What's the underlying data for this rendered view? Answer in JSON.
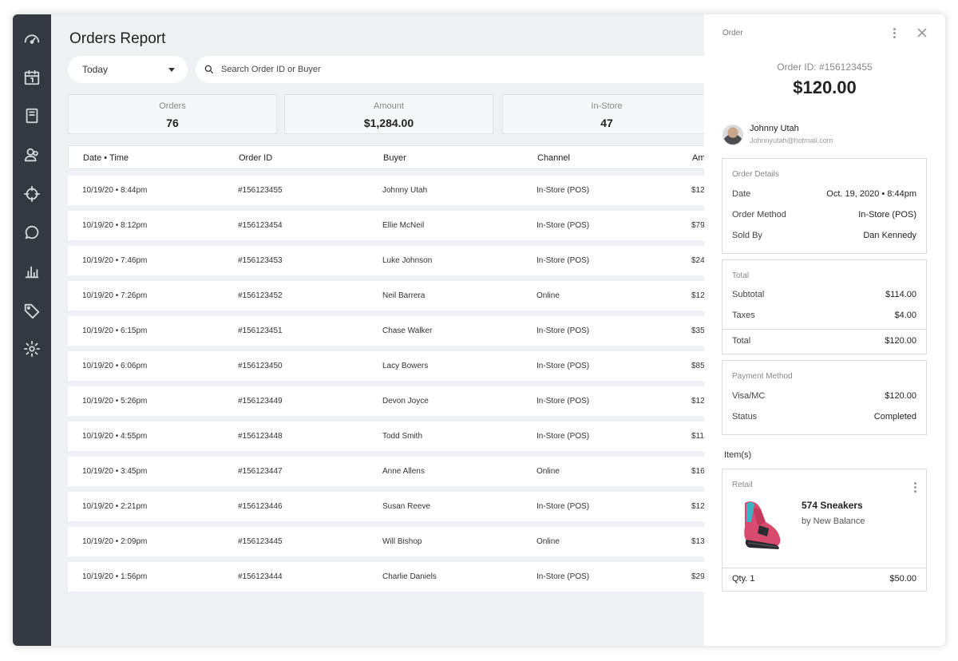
{
  "nav": {
    "items": [
      {
        "name": "dashboard-icon"
      },
      {
        "name": "calendar-icon"
      },
      {
        "name": "book-icon"
      },
      {
        "name": "users-icon"
      },
      {
        "name": "crosshair-icon"
      },
      {
        "name": "chat-icon"
      },
      {
        "name": "bar-chart-icon"
      },
      {
        "name": "tag-icon"
      },
      {
        "name": "gear-icon"
      }
    ]
  },
  "header": {
    "title": "Orders Report",
    "date_filter": "Today",
    "search_placeholder": "Search Order ID or Buyer"
  },
  "stats": [
    {
      "label": "Orders",
      "value": "76"
    },
    {
      "label": "Amount",
      "value": "$1,284.00"
    },
    {
      "label": "In-Store",
      "value": "47"
    }
  ],
  "table": {
    "columns": [
      "Date • Time",
      "Order ID",
      "Buyer",
      "Channel",
      "Am"
    ],
    "rows": [
      {
        "datetime": "10/19/20 • 8:44pm",
        "order_id": "#156123455",
        "buyer": "Johnny Utah",
        "channel": "In-Store (POS)",
        "amount": "$12"
      },
      {
        "datetime": "10/19/20 • 8:12pm",
        "order_id": "#156123454",
        "buyer": "Ellie McNeil",
        "channel": "In-Store (POS)",
        "amount": "$79"
      },
      {
        "datetime": "10/19/20 • 7:46pm",
        "order_id": "#156123453",
        "buyer": "Luke Johnson",
        "channel": "In-Store (POS)",
        "amount": "$24"
      },
      {
        "datetime": "10/19/20 • 7:26pm",
        "order_id": "#156123452",
        "buyer": "Neil Barrera",
        "channel": "Online",
        "amount": "$12"
      },
      {
        "datetime": "10/19/20 • 6:15pm",
        "order_id": "#156123451",
        "buyer": "Chase Walker",
        "channel": "In-Store (POS)",
        "amount": "$35"
      },
      {
        "datetime": "10/19/20 • 6:06pm",
        "order_id": "#156123450",
        "buyer": "Lacy Bowers",
        "channel": "In-Store (POS)",
        "amount": "$85"
      },
      {
        "datetime": "10/19/20 • 5:26pm",
        "order_id": "#156123449",
        "buyer": "Devon Joyce",
        "channel": "In-Store (POS)",
        "amount": "$12"
      },
      {
        "datetime": "10/19/20 • 4:55pm",
        "order_id": "#156123448",
        "buyer": "Todd Smith",
        "channel": "In-Store (POS)",
        "amount": "$11"
      },
      {
        "datetime": "10/19/20 • 3:45pm",
        "order_id": "#156123447",
        "buyer": "Anne Allens",
        "channel": "Online",
        "amount": "$16"
      },
      {
        "datetime": "10/19/20 • 2:21pm",
        "order_id": "#156123446",
        "buyer": "Susan Reeve",
        "channel": "In-Store (POS)",
        "amount": "$12"
      },
      {
        "datetime": "10/19/20 • 2:09pm",
        "order_id": "#156123445",
        "buyer": "Will Bishop",
        "channel": "Online",
        "amount": "$13"
      },
      {
        "datetime": "10/19/20 • 1:56pm",
        "order_id": "#156123444",
        "buyer": "Charlie Daniels",
        "channel": "In-Store (POS)",
        "amount": "$29"
      }
    ]
  },
  "panel": {
    "title": "Order",
    "order_id": "Order ID: #156123455",
    "total": "$120.00",
    "buyer_name": "Johnny Utah",
    "buyer_email": "Johnnyutah@hotmail.com",
    "details": {
      "heading": "Order Details",
      "date_label": "Date",
      "date_value": "Oct. 19, 2020 • 8:44pm",
      "method_label": "Order Method",
      "method_value": "In-Store (POS)",
      "sold_label": "Sold By",
      "sold_value": "Dan Kennedy"
    },
    "totals": {
      "heading": "Total",
      "subtotal_label": "Subtotal",
      "subtotal_value": "$114.00",
      "taxes_label": "Taxes",
      "taxes_value": "$4.00",
      "total_label": "Total",
      "total_value": "$120.00"
    },
    "payment": {
      "heading": "Payment Method",
      "card_label": "Visa/MC",
      "card_value": "$120.00",
      "status_label": "Status",
      "status_value": "Completed"
    },
    "items_heading": "Item(s)",
    "item": {
      "category": "Retail",
      "name": "574 Sneakers",
      "brand": "by New Balance",
      "qty": "Qty. 1",
      "price": "$50.00"
    }
  }
}
